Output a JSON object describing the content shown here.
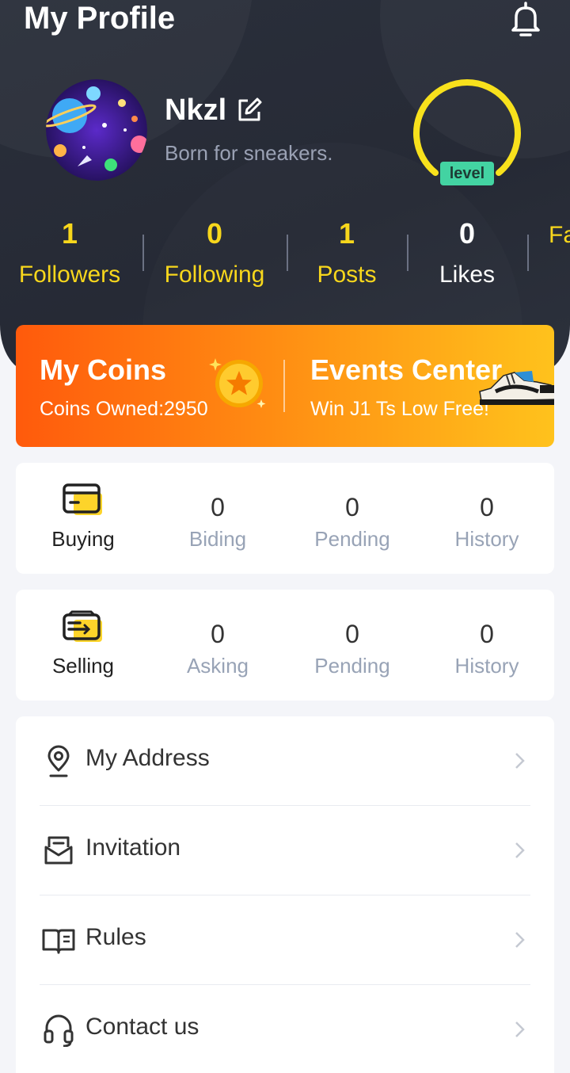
{
  "header": {
    "title": "My Profile"
  },
  "profile": {
    "name": "Nkzl",
    "bio": "Born for sneakers.",
    "level_label": "level"
  },
  "stats": [
    {
      "value": "1",
      "label": "Followers"
    },
    {
      "value": "0",
      "label": "Following"
    },
    {
      "value": "1",
      "label": "Posts"
    },
    {
      "value": "0",
      "label": "Likes"
    },
    {
      "value": "",
      "label": "Fa"
    }
  ],
  "banner": {
    "coins_title": "My Coins",
    "coins_sub": "Coins Owned:2950",
    "events_title": "Events Center",
    "events_sub": "Win J1 Ts Low Free!"
  },
  "buying": {
    "label": "Buying",
    "cols": [
      {
        "value": "0",
        "label": "Biding"
      },
      {
        "value": "0",
        "label": "Pending"
      },
      {
        "value": "0",
        "label": "History"
      }
    ]
  },
  "selling": {
    "label": "Selling",
    "cols": [
      {
        "value": "0",
        "label": "Asking"
      },
      {
        "value": "0",
        "label": "Pending"
      },
      {
        "value": "0",
        "label": "History"
      }
    ]
  },
  "menu": [
    {
      "label": "My Address",
      "icon": "location-pin-icon"
    },
    {
      "label": "Invitation",
      "icon": "invitation-icon"
    },
    {
      "label": "Rules",
      "icon": "book-icon"
    },
    {
      "label": "Contact us",
      "icon": "headset-icon"
    }
  ],
  "colors": {
    "accent_yellow": "#f8d71c",
    "level_green": "#43d3a2",
    "banner_start": "#ff5a0c",
    "banner_end": "#ffc21c"
  }
}
